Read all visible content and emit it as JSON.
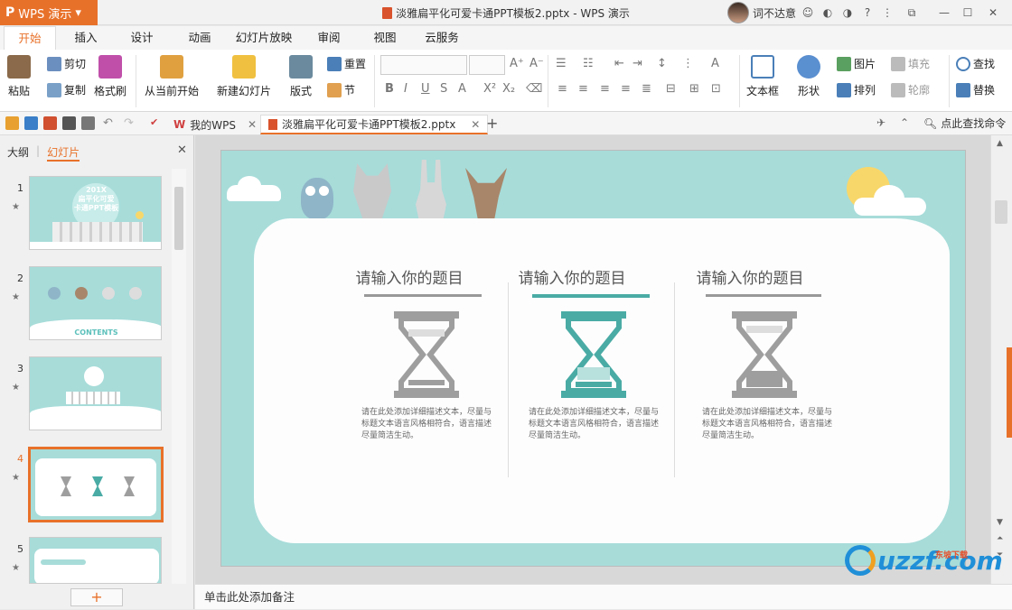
{
  "app": {
    "name": "WPS 演示",
    "logo": "P"
  },
  "window": {
    "title": "淡雅扁平化可爱卡通PPT模板2.pptx - WPS 演示",
    "user_name": "词不达意"
  },
  "tabs": [
    "开始",
    "插入",
    "设计",
    "动画",
    "幻灯片放映",
    "审阅",
    "视图",
    "云服务"
  ],
  "active_tab": "开始",
  "ribbon": {
    "paste": "粘贴",
    "cut": "剪切",
    "copy": "复制",
    "format_painter": "格式刷",
    "from_current": "从当前开始",
    "new_slide": "新建幻灯片",
    "layout": "版式",
    "reset": "重置",
    "section": "节",
    "textbox": "文本框",
    "shape": "形状",
    "picture": "图片",
    "arrange": "排列",
    "fill": "填充",
    "outline": "轮廓",
    "find": "查找",
    "replace": "替换"
  },
  "doc_tabs": [
    {
      "label": "我的WPS"
    },
    {
      "label": "淡雅扁平化可爱卡通PPT模板2.pptx"
    }
  ],
  "quick": {
    "search": "点此查找命令"
  },
  "left_pane": {
    "tab_outline": "大纲",
    "tab_slides": "幻灯片",
    "slides": [
      {
        "num": "1",
        "title_line1": "201X",
        "title_line2": "扁平化可爱",
        "title_line3": "卡通PPT模板"
      },
      {
        "num": "2",
        "label": "CONTENTS"
      },
      {
        "num": "3"
      },
      {
        "num": "4"
      },
      {
        "num": "5"
      }
    ],
    "selected": 4
  },
  "slide": {
    "columns": [
      {
        "title": "请输入你的题目",
        "desc": "请在此处添加详细描述文本，尽量与标题文本语言风格相符合，语言描述尽量简洁生动。"
      },
      {
        "title": "请输入你的题目",
        "desc": "请在此处添加详细描述文本，尽量与标题文本语言风格相符合，语言描述尽量简洁生动。"
      },
      {
        "title": "请输入你的题目",
        "desc": "请在此处添加详细描述文本，尽量与标题文本语言风格相符合，语言描述尽量简洁生动。"
      }
    ]
  },
  "notes_placeholder": "单击此处添加备注",
  "watermark": {
    "text": "uzzf.com",
    "sub": "东坡下载"
  },
  "colors": {
    "accent": "#e8712a",
    "slide_bg": "#a7dcd9",
    "teal": "#4aaba5",
    "gray_icon": "#9e9e9e"
  }
}
